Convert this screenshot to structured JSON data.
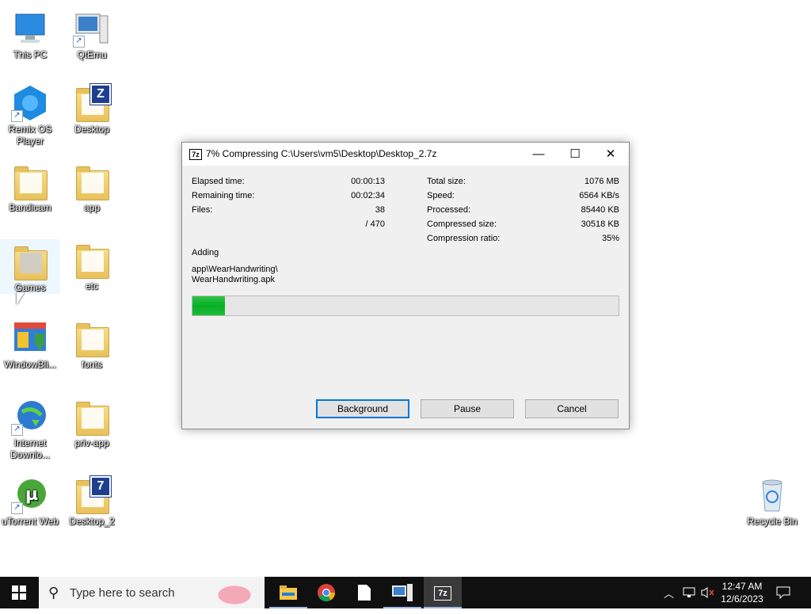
{
  "desktop": {
    "icons": [
      {
        "label": "This PC",
        "icon": "this-pc-icon"
      },
      {
        "label": "QtEmu",
        "icon": "qtemu-icon"
      },
      {
        "label": "Remix OS Player",
        "icon": "remix-os-icon"
      },
      {
        "label": "Desktop",
        "icon": "zip-folder-icon"
      },
      {
        "label": "Bandicam",
        "icon": "folder-icon"
      },
      {
        "label": "app",
        "icon": "folder-icon"
      },
      {
        "label": "Games",
        "icon": "folder-icon"
      },
      {
        "label": "etc",
        "icon": "folder-icon"
      },
      {
        "label": "WindowBli...",
        "icon": "windowblinds-icon"
      },
      {
        "label": "fonts",
        "icon": "folder-icon"
      },
      {
        "label": "Internet Downlo...",
        "icon": "internet-download-manager-icon"
      },
      {
        "label": "priv-app",
        "icon": "folder-icon"
      },
      {
        "label": "uTorrent Web",
        "icon": "utorrent-icon"
      },
      {
        "label": "Desktop_2",
        "icon": "7z-folder-icon"
      },
      {
        "label": "Recycle Bin",
        "icon": "recycle-bin-icon"
      }
    ]
  },
  "dialog": {
    "title": "7% Compressing C:\\Users\\vm5\\Desktop\\Desktop_2.7z",
    "title_icon_text": "7z",
    "minimize_glyph": "—",
    "maximize_glyph": "☐",
    "close_glyph": "✕",
    "stats_left": [
      {
        "label": "Elapsed time:",
        "value": "00:00:13"
      },
      {
        "label": "Remaining time:",
        "value": "00:02:34"
      },
      {
        "label": "Files:",
        "value": "38"
      },
      {
        "label": "",
        "value": "/ 470"
      }
    ],
    "stats_right": [
      {
        "label": "Total size:",
        "value": "1076 MB"
      },
      {
        "label": "Speed:",
        "value": "6564 KB/s"
      },
      {
        "label": "Processed:",
        "value": "85440 KB"
      },
      {
        "label": "Compressed size:",
        "value": "30518 KB"
      },
      {
        "label": "Compression ratio:",
        "value": "35%"
      }
    ],
    "action": "Adding",
    "file_line1": "app\\WearHandwriting\\",
    "file_line2": "WearHandwriting.apk",
    "progress_percent": 7.7,
    "buttons": {
      "background": "Background",
      "pause": "Pause",
      "cancel": "Cancel"
    }
  },
  "taskbar": {
    "search_placeholder": "Type here to search",
    "clock_time": "12:47 AM",
    "clock_date": "12/6/2023",
    "apps": [
      "file-explorer-icon",
      "chrome-icon",
      "notepad-icon",
      "qtemu-icon",
      "7zip-icon"
    ],
    "active_app_label": "7z"
  },
  "colors": {
    "progress_fill": "#06b025",
    "taskbar": "#101010",
    "accent": "#0078d7"
  }
}
